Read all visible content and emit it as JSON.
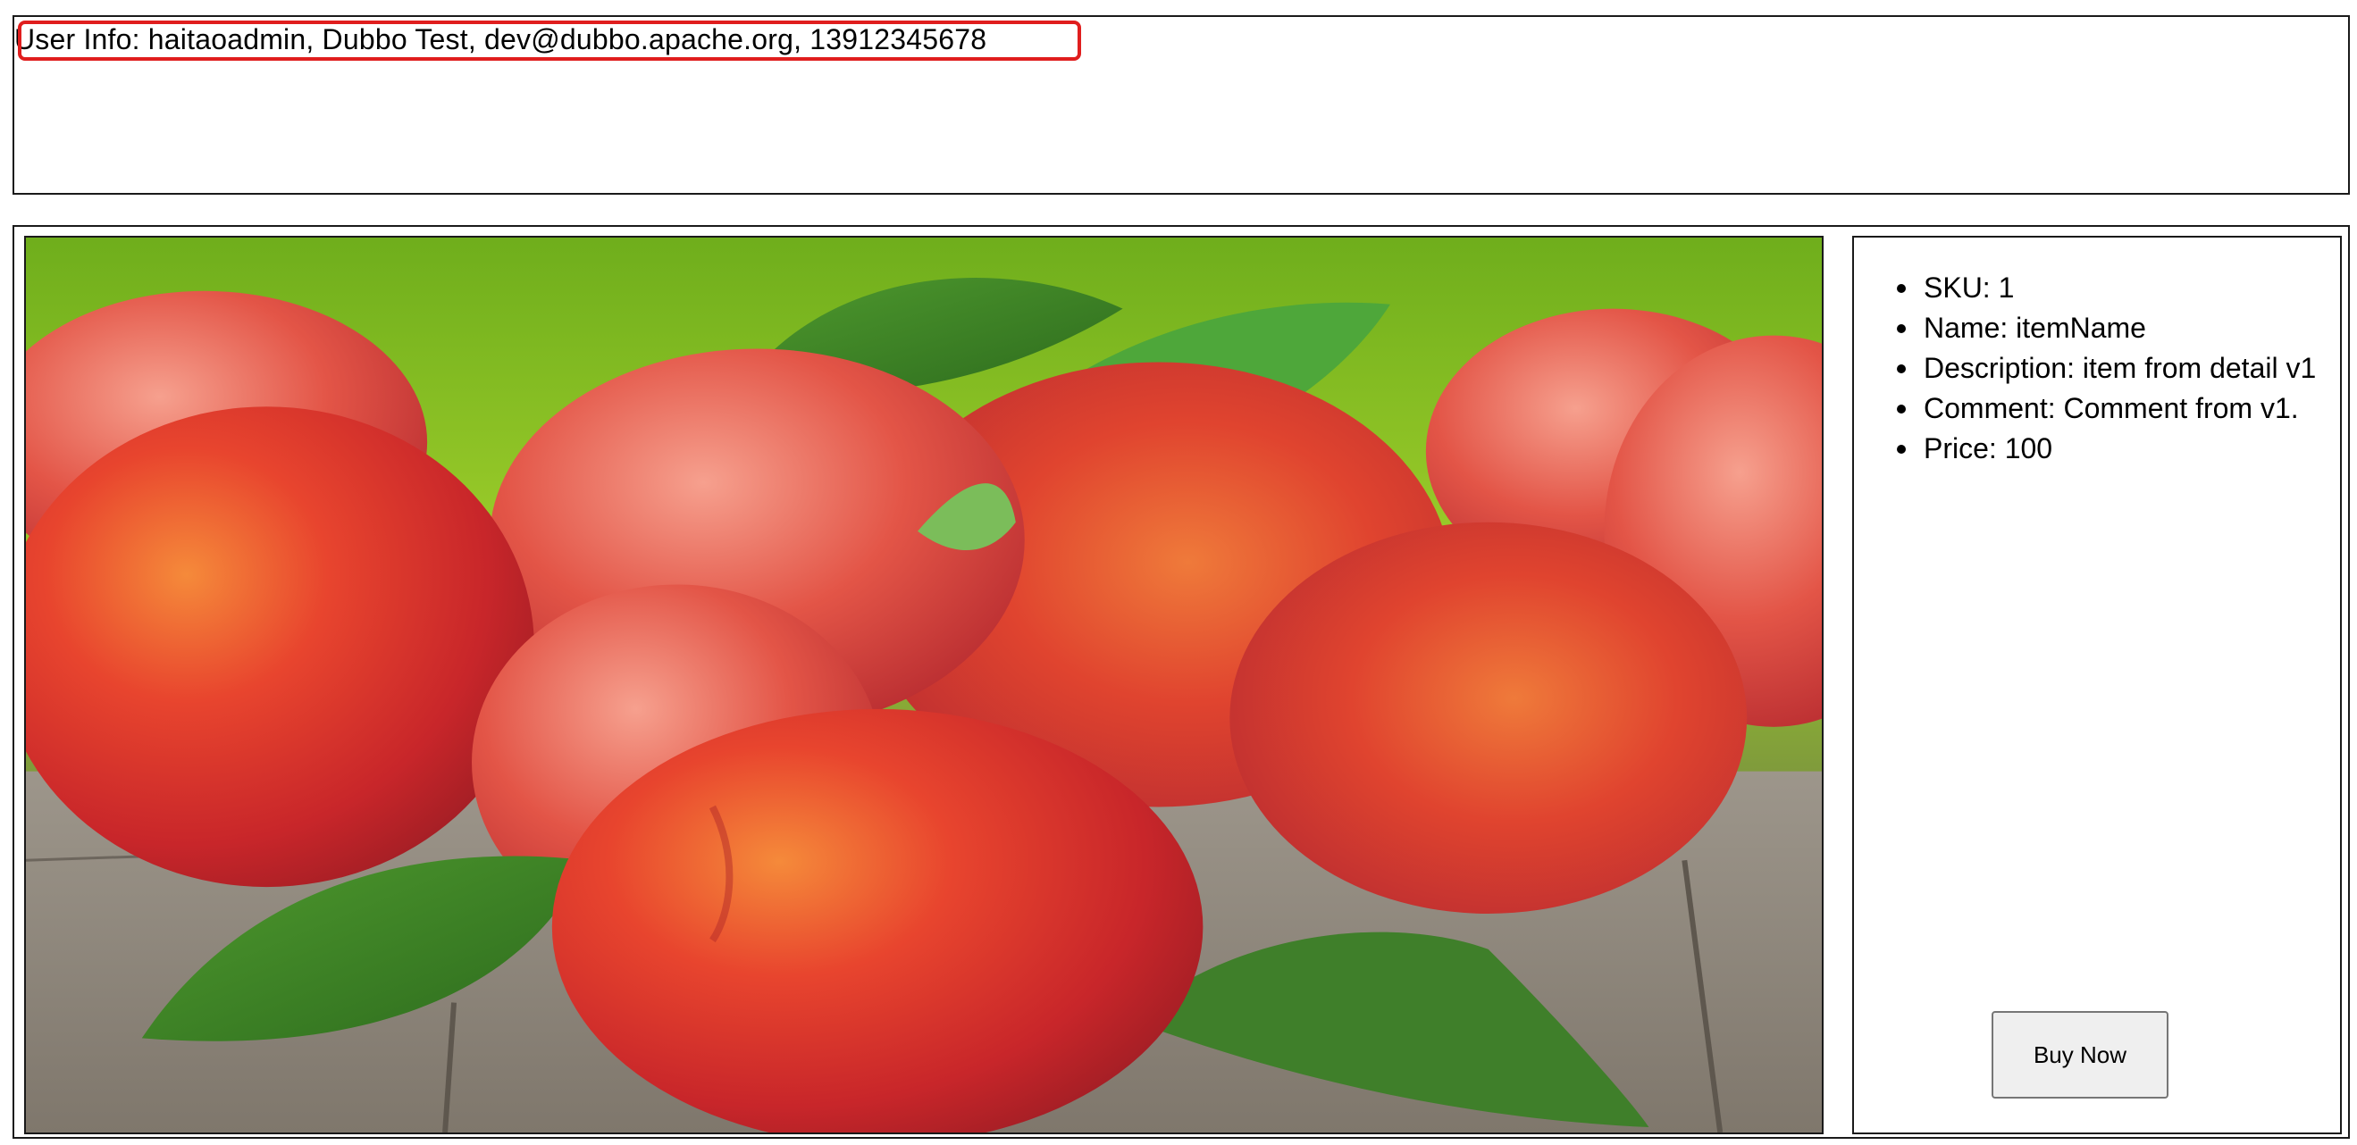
{
  "user_panel": {
    "user_info": "User Info: haitaoadmin, Dubbo Test, dev@dubbo.apache.org, 13912345678"
  },
  "product": {
    "image_alt": "Peaches on a wooden table with green leaves",
    "details": [
      {
        "label": "SKU: 1"
      },
      {
        "label": "Name: itemName"
      },
      {
        "label": "Description: item from detail v1"
      },
      {
        "label": "Comment: Comment from v1."
      },
      {
        "label": "Price: 100"
      }
    ],
    "buy_label": "Buy Now"
  },
  "colors": {
    "highlight": "#e01e1e",
    "border": "#1a1a1a",
    "button_bg": "#efefef"
  }
}
